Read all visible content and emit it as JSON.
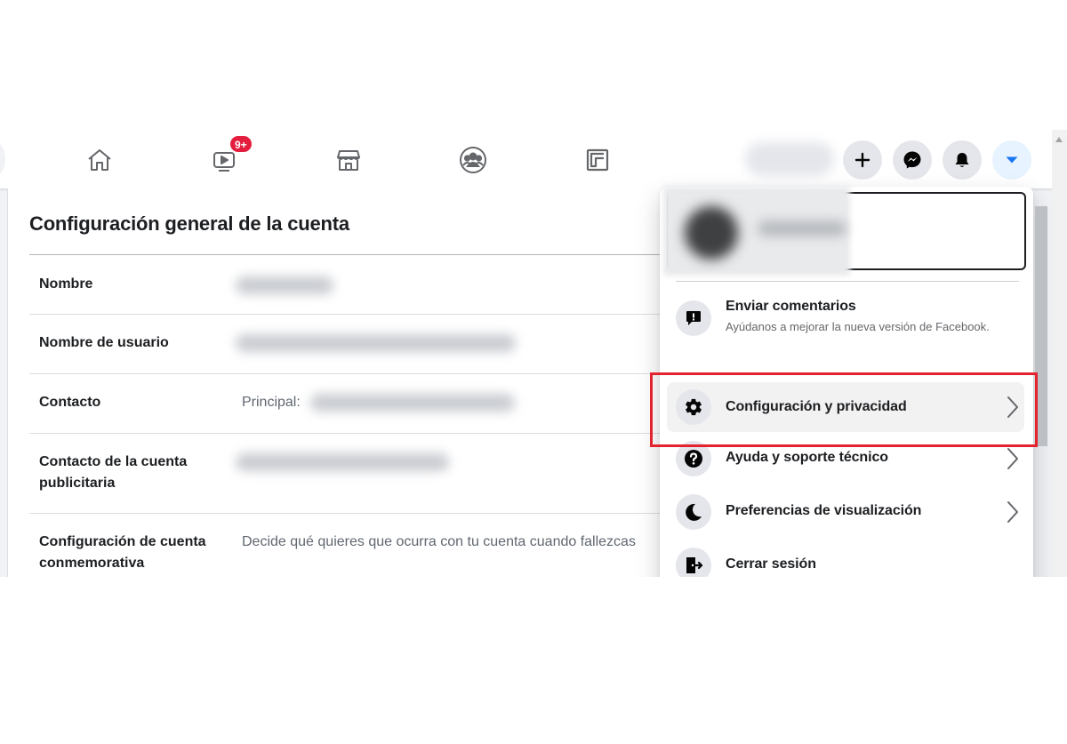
{
  "nav": {
    "video_badge": "9+"
  },
  "settings": {
    "title": "Configuración general de la cuenta",
    "rows": [
      {
        "label": "Nombre",
        "value": ""
      },
      {
        "label": "Nombre de usuario",
        "value": ""
      },
      {
        "label": "Contacto",
        "value": "Principal:"
      },
      {
        "label": "Contacto de la cuenta publicitaria",
        "value": ""
      },
      {
        "label": "Configuración de cuenta conmemorativa",
        "value": "Decide qué quieres que ocurra con tu cuenta cuando fallezcas"
      }
    ]
  },
  "menu": {
    "items": [
      {
        "label": "Enviar comentarios",
        "sublabel": "Ayúdanos a mejorar la nueva versión de Facebook.",
        "icon": "feedback-icon"
      },
      {
        "label": "Configuración y privacidad",
        "icon": "gear-icon",
        "highlighted": true
      },
      {
        "label": "Ayuda y soporte técnico",
        "icon": "help-icon"
      },
      {
        "label": "Preferencias de visualización",
        "icon": "moon-icon"
      },
      {
        "label": "Cerrar sesión",
        "icon": "logout-icon"
      }
    ]
  },
  "colors": {
    "accent": "#1877f2",
    "badge": "#e41e3f",
    "highlight_box": "#e3232d"
  }
}
